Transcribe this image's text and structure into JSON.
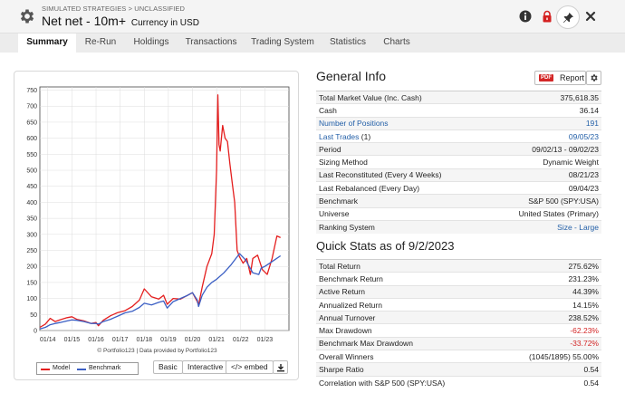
{
  "header": {
    "breadcrumb": "SIMULATED STRATEGIES > UNCLASSIFIED",
    "title": "Net net - 10m+",
    "subtitle": "Currency in USD"
  },
  "tabs": [
    {
      "label": "Summary",
      "active": true
    },
    {
      "label": "Re-Run"
    },
    {
      "label": "Holdings"
    },
    {
      "label": "Transactions"
    },
    {
      "label": "Trading System"
    },
    {
      "label": "Statistics"
    },
    {
      "label": "Charts"
    }
  ],
  "general_info": {
    "title": "General Info",
    "report_badge": "PDF",
    "report_label": "Report",
    "rows": [
      {
        "label": "Total Market Value (Inc. Cash)",
        "value": "375,618.35"
      },
      {
        "label": "Cash",
        "value": "36.14"
      },
      {
        "label": "Number of Positions",
        "value": "191",
        "link": true
      },
      {
        "label": "Last Trades",
        "suffix": " (1)",
        "value": "09/05/23",
        "link": true
      },
      {
        "label": "Period",
        "value": "09/02/13 - 09/02/23"
      },
      {
        "label": "Sizing Method",
        "value": "Dynamic Weight"
      },
      {
        "label": "Last Reconstituted (Every 4 Weeks)",
        "value": "08/21/23"
      },
      {
        "label": "Last Rebalanced (Every Day)",
        "value": "09/04/23"
      },
      {
        "label": "Benchmark",
        "value": "S&P 500 (SPY:USA)"
      },
      {
        "label": "Universe",
        "value": "United States (Primary)"
      },
      {
        "label": "Ranking System",
        "value": "Size - Large",
        "link_value": true
      }
    ]
  },
  "quick_stats": {
    "title": "Quick Stats as of 9/2/2023",
    "rows": [
      {
        "label": "Total Return",
        "value": "275.62%"
      },
      {
        "label": "Benchmark Return",
        "value": "231.23%"
      },
      {
        "label": "Active Return",
        "value": "44.39%"
      },
      {
        "label": "Annualized Return",
        "value": "14.15%"
      },
      {
        "label": "Annual Turnover",
        "value": "238.52%"
      },
      {
        "label": "Max Drawdown",
        "value": "-62.23%",
        "negative": true
      },
      {
        "label": "Benchmark Max Drawdown",
        "value": "-33.72%",
        "negative": true
      },
      {
        "label": "Overall Winners",
        "value": "(1045/1895) 55.00%"
      },
      {
        "label": "Sharpe Ratio",
        "value": "0.54"
      },
      {
        "label": "Correlation with S&P 500 (SPY:USA)",
        "value": "0.54"
      }
    ]
  },
  "chart_controls": {
    "credit": "© Portfolio123 | Data provided by Portfolio123",
    "legend_model": "Model",
    "legend_benchmark": "Benchmark",
    "basic": "Basic",
    "interactive": "Interactive",
    "embed": "</> embed"
  },
  "colors": {
    "model": "#e41e1e",
    "benchmark": "#3b5fc4",
    "link": "#2460a8",
    "negative": "#d32626"
  },
  "chart_data": {
    "type": "line",
    "y_ticks": [
      0,
      50,
      100,
      150,
      200,
      250,
      300,
      350,
      400,
      450,
      500,
      550,
      600,
      650,
      700,
      750
    ],
    "x_ticks": [
      "01/14",
      "01/15",
      "01/16",
      "01/17",
      "01/18",
      "01/19",
      "01/20",
      "01/21",
      "01/22",
      "01/23"
    ],
    "ylim": [
      0,
      760
    ],
    "grid": true,
    "x_years": [
      2013.67,
      2024
    ],
    "series": [
      {
        "name": "Model",
        "x": [
          2013.67,
          2013.9,
          2014.1,
          2014.3,
          2014.5,
          2014.8,
          2015.0,
          2015.2,
          2015.5,
          2015.8,
          2016.0,
          2016.1,
          2016.3,
          2016.6,
          2016.9,
          2017.2,
          2017.5,
          2017.8,
          2018.0,
          2018.3,
          2018.6,
          2018.8,
          2018.95,
          2019.2,
          2019.5,
          2019.8,
          2020.0,
          2020.2,
          2020.25,
          2020.4,
          2020.6,
          2020.8,
          2020.9,
          2021.0,
          2021.05,
          2021.1,
          2021.15,
          2021.25,
          2021.35,
          2021.45,
          2021.55,
          2021.65,
          2021.75,
          2021.85,
          2021.95,
          2022.1,
          2022.25,
          2022.4,
          2022.5,
          2022.7,
          2022.9,
          2023.1,
          2023.3,
          2023.5,
          2023.65
        ],
        "values": [
          10,
          20,
          38,
          28,
          33,
          40,
          43,
          35,
          30,
          22,
          25,
          15,
          32,
          46,
          56,
          62,
          75,
          95,
          130,
          105,
          98,
          110,
          82,
          100,
          98,
          110,
          118,
          90,
          80,
          135,
          200,
          240,
          300,
          500,
          735,
          580,
          560,
          640,
          600,
          590,
          520,
          460,
          400,
          250,
          230,
          210,
          225,
          175,
          225,
          235,
          190,
          175,
          225,
          295,
          290
        ]
      },
      {
        "name": "Benchmark",
        "x": [
          2013.67,
          2013.9,
          2014.1,
          2014.3,
          2014.5,
          2014.8,
          2015.0,
          2015.2,
          2015.5,
          2015.8,
          2016.0,
          2016.1,
          2016.3,
          2016.6,
          2016.9,
          2017.2,
          2017.5,
          2017.8,
          2018.0,
          2018.3,
          2018.6,
          2018.8,
          2018.95,
          2019.2,
          2019.5,
          2019.8,
          2020.0,
          2020.2,
          2020.25,
          2020.4,
          2020.6,
          2020.8,
          2021.0,
          2021.3,
          2021.6,
          2021.95,
          2022.2,
          2022.5,
          2022.75,
          2022.85,
          2023.0,
          2023.2,
          2023.4,
          2023.65
        ],
        "values": [
          5,
          10,
          18,
          22,
          25,
          30,
          33,
          32,
          28,
          22,
          22,
          20,
          28,
          35,
          45,
          55,
          60,
          72,
          85,
          80,
          88,
          92,
          70,
          90,
          100,
          110,
          118,
          95,
          75,
          110,
          135,
          150,
          160,
          180,
          205,
          240,
          220,
          180,
          175,
          195,
          200,
          210,
          220,
          233
        ]
      }
    ]
  }
}
